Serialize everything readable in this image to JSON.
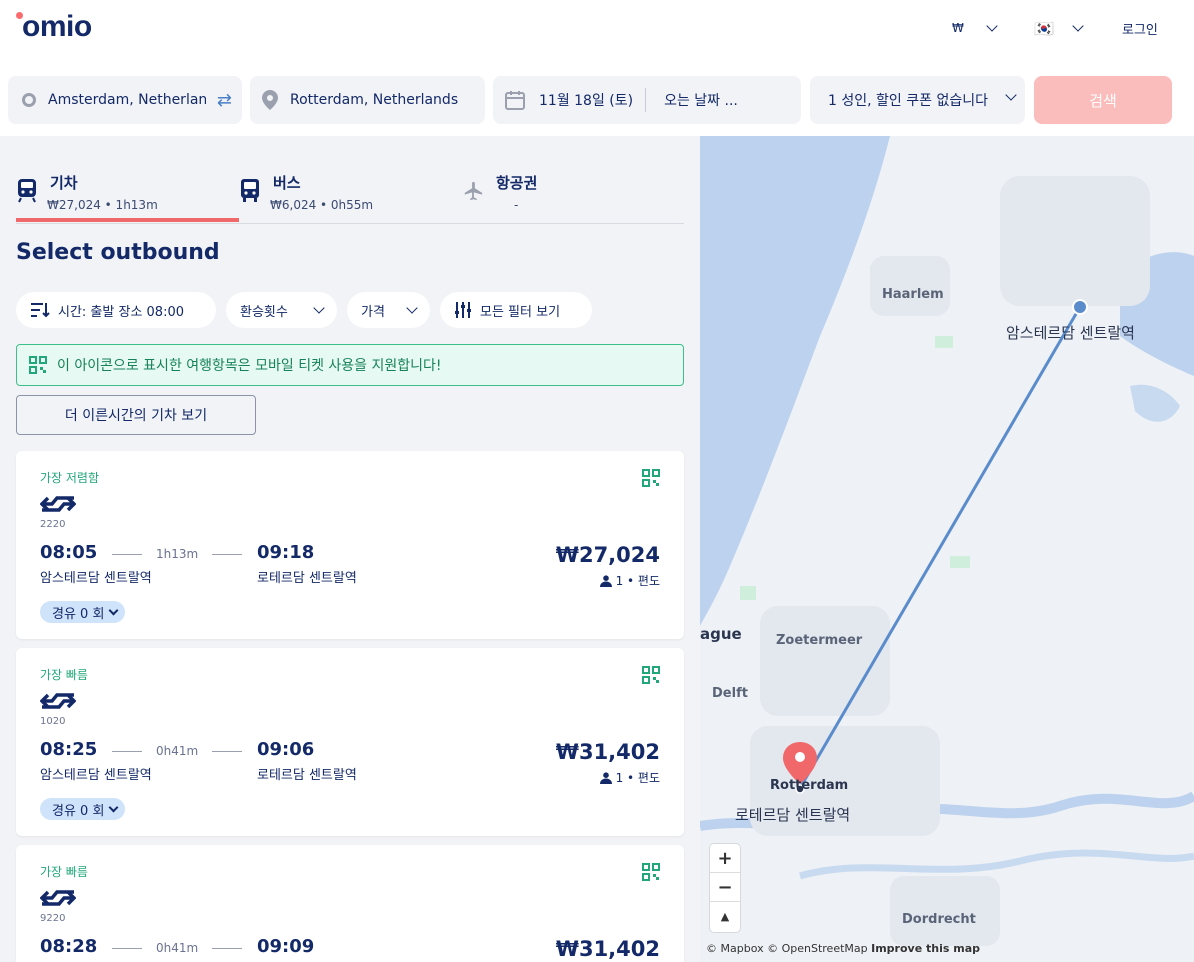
{
  "header": {
    "logo": "omio",
    "currency": "₩",
    "language_flag": "🇰🇷",
    "login": "로그인"
  },
  "search": {
    "from": "Amsterdam, Netherlands",
    "to": "Rotterdam, Netherlands",
    "depart_date": "11월 18일 (토)",
    "return_placeholder": "오는 날짜 ...",
    "passengers": "1 성인, 할인 쿠폰 없습니다",
    "search_button": "검색"
  },
  "tabs": [
    {
      "title": "기차",
      "sub": "₩27,024 • 1h13m",
      "active": true
    },
    {
      "title": "버스",
      "sub": "₩6,024 • 0h55m",
      "active": false
    },
    {
      "title": "항공권",
      "sub": "-",
      "active": false
    }
  ],
  "results_title": "Select outbound",
  "filters": {
    "sort": "시간: 출발 장소 08:00",
    "transfers": "환승횟수",
    "price": "가격",
    "all_filters": "모든 필터 보기"
  },
  "notice": "이 아이콘으로 표시한 여행항목은 모바일 티켓 사용을 지원합니다!",
  "earlier_button": "더 이른시간의 기차 보기",
  "journeys": [
    {
      "badge": "가장 저렴함",
      "train_no": "2220",
      "dep_time": "08:05",
      "arr_time": "09:18",
      "duration": "1h13m",
      "dep_station": "암스테르담 센트랄역",
      "arr_station": "로테르담 센트랄역",
      "price": "₩27,024",
      "pax": "1 • 편도",
      "stops": "경유 0 회"
    },
    {
      "badge": "가장 빠름",
      "train_no": "1020",
      "dep_time": "08:25",
      "arr_time": "09:06",
      "duration": "0h41m",
      "dep_station": "암스테르담 센트랄역",
      "arr_station": "로테르담 센트랄역",
      "price": "₩31,402",
      "pax": "1 • 편도",
      "stops": "경유 0 회"
    },
    {
      "badge": "가장 빠름",
      "train_no": "9220",
      "dep_time": "08:28",
      "arr_time": "09:09",
      "duration": "0h41m",
      "dep_station": "",
      "arr_station": "",
      "price": "₩31,402",
      "pax": "",
      "stops": ""
    }
  ],
  "map": {
    "labels": {
      "haarlem": "Haarlem",
      "amsterdam_station": "암스테르담 센트랄역",
      "hague": "ague",
      "zoetermeer": "Zoetermeer",
      "delft": "Delft",
      "rotterdam": "Rotterdam",
      "rotterdam_station": "로테르담 센트랄역",
      "dordrecht": "Dordrecht"
    },
    "zoom_in": "+",
    "zoom_out": "−",
    "compass": "▲",
    "attribution_mapbox": "© Mapbox",
    "attribution_osm": "© OpenStreetMap",
    "attribution_improve": "Improve this map"
  }
}
